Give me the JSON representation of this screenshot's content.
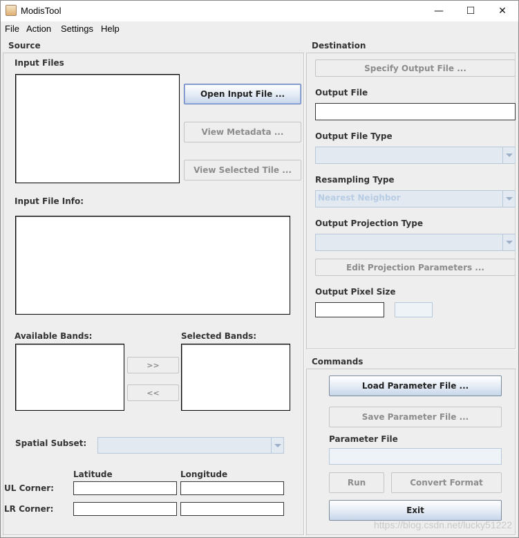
{
  "window": {
    "title": "ModisTool",
    "minimize_glyph": "—",
    "maximize_glyph": "☐",
    "close_glyph": "✕"
  },
  "menu": {
    "items": [
      "File",
      "Action",
      "Settings",
      "Help"
    ]
  },
  "source": {
    "title": "Source",
    "input_files_label": "Input Files",
    "open_input_button": "Open Input File ...",
    "view_metadata_button": "View Metadata ...",
    "view_selected_tile_button": "View Selected Tile  ...",
    "input_file_info_label": "Input File Info:",
    "available_bands_label": "Available Bands:",
    "selected_bands_label": "Selected Bands:",
    "add_band_button": ">>",
    "remove_band_button": "<<",
    "spatial_subset_label": "Spatial Subset:",
    "spatial_subset_value": "",
    "latitude_label": "Latitude",
    "longitude_label": "Longitude",
    "ul_corner_label": "UL Corner:",
    "lr_corner_label": "LR Corner:"
  },
  "destination": {
    "title": "Destination",
    "specify_output_button": "Specify Output File ...",
    "output_file_label": "Output File",
    "output_file_value": "",
    "output_file_type_label": "Output File Type",
    "output_file_type_value": "",
    "resampling_type_label": "Resampling Type",
    "resampling_type_value": "Nearest Neighbor",
    "output_projection_label": "Output Projection Type",
    "output_projection_value": "",
    "edit_projection_button": "Edit Projection Parameters ...",
    "output_pixel_size_label": "Output Pixel Size"
  },
  "commands": {
    "title": "Commands",
    "load_parameter_button": "Load Parameter File ...",
    "save_parameter_button": "Save Parameter File ...",
    "parameter_file_label": "Parameter File",
    "run_button": "Run",
    "convert_format_button": "Convert Format",
    "exit_button": "Exit"
  },
  "watermark": "https://blog.csdn.net/lucky51222"
}
